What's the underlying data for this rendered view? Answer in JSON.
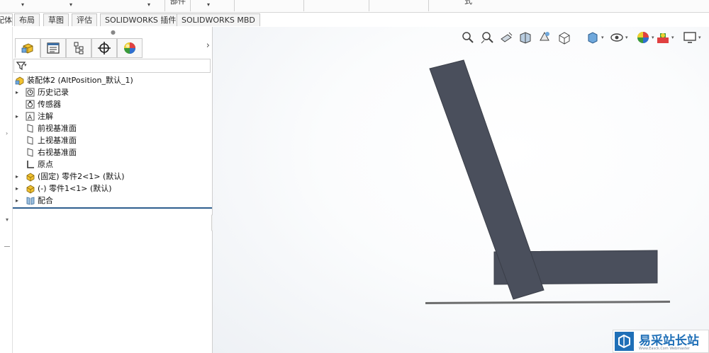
{
  "top_strip": {
    "cut_label": "部件",
    "cut_label_right": "式"
  },
  "tabs": [
    {
      "label": "配体"
    },
    {
      "label": "布局"
    },
    {
      "label": "草图"
    },
    {
      "label": "评估"
    },
    {
      "label": "SOLIDWORKS 插件"
    },
    {
      "label": "SOLIDWORKS MBD"
    }
  ],
  "panel": {
    "tabs": [
      {
        "icon": "featuremanager-icon",
        "active": true
      },
      {
        "icon": "propertymanager-icon"
      },
      {
        "icon": "configurationmanager-icon"
      },
      {
        "icon": "dimxpert-icon"
      },
      {
        "icon": "displaymanager-icon"
      }
    ],
    "more_glyph": "›",
    "filter_icon": "filter-icon"
  },
  "tree": {
    "root": {
      "label": "装配体2  (AltPosition_默认_1)",
      "icon": "assembly-icon"
    },
    "items": [
      {
        "label": "历史记录",
        "icon": "history-icon",
        "expandable": true
      },
      {
        "label": "传感器",
        "icon": "sensor-icon",
        "expandable": false
      },
      {
        "label": "注解",
        "icon": "annotation-icon",
        "expandable": true
      },
      {
        "label": "前视基准面",
        "icon": "plane-icon",
        "expandable": false
      },
      {
        "label": "上视基准面",
        "icon": "plane-icon",
        "expandable": false
      },
      {
        "label": "右视基准面",
        "icon": "plane-icon",
        "expandable": false
      },
      {
        "label": "原点",
        "icon": "origin-icon",
        "expandable": false
      },
      {
        "label": "(固定) 零件2<1> (默认)",
        "icon": "part-icon",
        "expandable": true
      },
      {
        "label": "(-) 零件1<1> (默认)",
        "icon": "part-icon",
        "expandable": true
      },
      {
        "label": "配合",
        "icon": "mates-icon",
        "expandable": true
      }
    ]
  },
  "heads_up_toolbar": [
    "zoom-to-fit-icon",
    "zoom-to-area-icon",
    "previous-view-icon",
    "section-view-icon",
    "dynamic-annotation-icon",
    "view-orientation-icon",
    "display-style-icon",
    "hide-show-items-icon",
    "edit-appearance-icon",
    "apply-scene-icon",
    "view-settings-icon"
  ],
  "colors": {
    "part_fill": "#4a4f5c",
    "accent": "#2f5f8f",
    "watermark_blue": "#1f6fb7"
  },
  "watermark": {
    "text": "易采站长站",
    "sub": "Www.Easck.Com Webmaster"
  }
}
